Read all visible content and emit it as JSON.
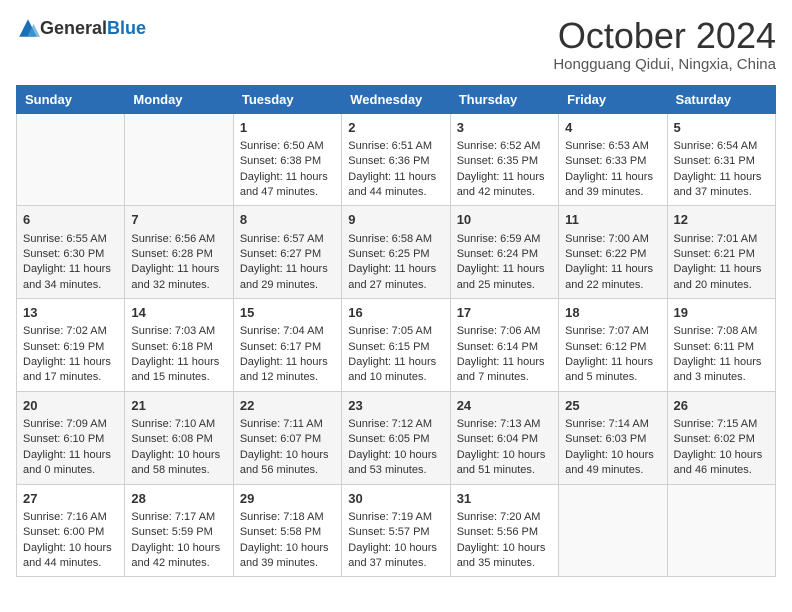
{
  "header": {
    "logo_general": "General",
    "logo_blue": "Blue",
    "month": "October 2024",
    "location": "Hongguang Qidui, Ningxia, China"
  },
  "days_of_week": [
    "Sunday",
    "Monday",
    "Tuesday",
    "Wednesday",
    "Thursday",
    "Friday",
    "Saturday"
  ],
  "weeks": [
    [
      {
        "day": "",
        "empty": true
      },
      {
        "day": "",
        "empty": true
      },
      {
        "day": "1",
        "sunrise": "6:50 AM",
        "sunset": "6:38 PM",
        "daylight": "11 hours and 47 minutes."
      },
      {
        "day": "2",
        "sunrise": "6:51 AM",
        "sunset": "6:36 PM",
        "daylight": "11 hours and 44 minutes."
      },
      {
        "day": "3",
        "sunrise": "6:52 AM",
        "sunset": "6:35 PM",
        "daylight": "11 hours and 42 minutes."
      },
      {
        "day": "4",
        "sunrise": "6:53 AM",
        "sunset": "6:33 PM",
        "daylight": "11 hours and 39 minutes."
      },
      {
        "day": "5",
        "sunrise": "6:54 AM",
        "sunset": "6:31 PM",
        "daylight": "11 hours and 37 minutes."
      }
    ],
    [
      {
        "day": "6",
        "sunrise": "6:55 AM",
        "sunset": "6:30 PM",
        "daylight": "11 hours and 34 minutes."
      },
      {
        "day": "7",
        "sunrise": "6:56 AM",
        "sunset": "6:28 PM",
        "daylight": "11 hours and 32 minutes."
      },
      {
        "day": "8",
        "sunrise": "6:57 AM",
        "sunset": "6:27 PM",
        "daylight": "11 hours and 29 minutes."
      },
      {
        "day": "9",
        "sunrise": "6:58 AM",
        "sunset": "6:25 PM",
        "daylight": "11 hours and 27 minutes."
      },
      {
        "day": "10",
        "sunrise": "6:59 AM",
        "sunset": "6:24 PM",
        "daylight": "11 hours and 25 minutes."
      },
      {
        "day": "11",
        "sunrise": "7:00 AM",
        "sunset": "6:22 PM",
        "daylight": "11 hours and 22 minutes."
      },
      {
        "day": "12",
        "sunrise": "7:01 AM",
        "sunset": "6:21 PM",
        "daylight": "11 hours and 20 minutes."
      }
    ],
    [
      {
        "day": "13",
        "sunrise": "7:02 AM",
        "sunset": "6:19 PM",
        "daylight": "11 hours and 17 minutes."
      },
      {
        "day": "14",
        "sunrise": "7:03 AM",
        "sunset": "6:18 PM",
        "daylight": "11 hours and 15 minutes."
      },
      {
        "day": "15",
        "sunrise": "7:04 AM",
        "sunset": "6:17 PM",
        "daylight": "11 hours and 12 minutes."
      },
      {
        "day": "16",
        "sunrise": "7:05 AM",
        "sunset": "6:15 PM",
        "daylight": "11 hours and 10 minutes."
      },
      {
        "day": "17",
        "sunrise": "7:06 AM",
        "sunset": "6:14 PM",
        "daylight": "11 hours and 7 minutes."
      },
      {
        "day": "18",
        "sunrise": "7:07 AM",
        "sunset": "6:12 PM",
        "daylight": "11 hours and 5 minutes."
      },
      {
        "day": "19",
        "sunrise": "7:08 AM",
        "sunset": "6:11 PM",
        "daylight": "11 hours and 3 minutes."
      }
    ],
    [
      {
        "day": "20",
        "sunrise": "7:09 AM",
        "sunset": "6:10 PM",
        "daylight": "11 hours and 0 minutes."
      },
      {
        "day": "21",
        "sunrise": "7:10 AM",
        "sunset": "6:08 PM",
        "daylight": "10 hours and 58 minutes."
      },
      {
        "day": "22",
        "sunrise": "7:11 AM",
        "sunset": "6:07 PM",
        "daylight": "10 hours and 56 minutes."
      },
      {
        "day": "23",
        "sunrise": "7:12 AM",
        "sunset": "6:05 PM",
        "daylight": "10 hours and 53 minutes."
      },
      {
        "day": "24",
        "sunrise": "7:13 AM",
        "sunset": "6:04 PM",
        "daylight": "10 hours and 51 minutes."
      },
      {
        "day": "25",
        "sunrise": "7:14 AM",
        "sunset": "6:03 PM",
        "daylight": "10 hours and 49 minutes."
      },
      {
        "day": "26",
        "sunrise": "7:15 AM",
        "sunset": "6:02 PM",
        "daylight": "10 hours and 46 minutes."
      }
    ],
    [
      {
        "day": "27",
        "sunrise": "7:16 AM",
        "sunset": "6:00 PM",
        "daylight": "10 hours and 44 minutes."
      },
      {
        "day": "28",
        "sunrise": "7:17 AM",
        "sunset": "5:59 PM",
        "daylight": "10 hours and 42 minutes."
      },
      {
        "day": "29",
        "sunrise": "7:18 AM",
        "sunset": "5:58 PM",
        "daylight": "10 hours and 39 minutes."
      },
      {
        "day": "30",
        "sunrise": "7:19 AM",
        "sunset": "5:57 PM",
        "daylight": "10 hours and 37 minutes."
      },
      {
        "day": "31",
        "sunrise": "7:20 AM",
        "sunset": "5:56 PM",
        "daylight": "10 hours and 35 minutes."
      },
      {
        "day": "",
        "empty": true
      },
      {
        "day": "",
        "empty": true
      }
    ]
  ]
}
